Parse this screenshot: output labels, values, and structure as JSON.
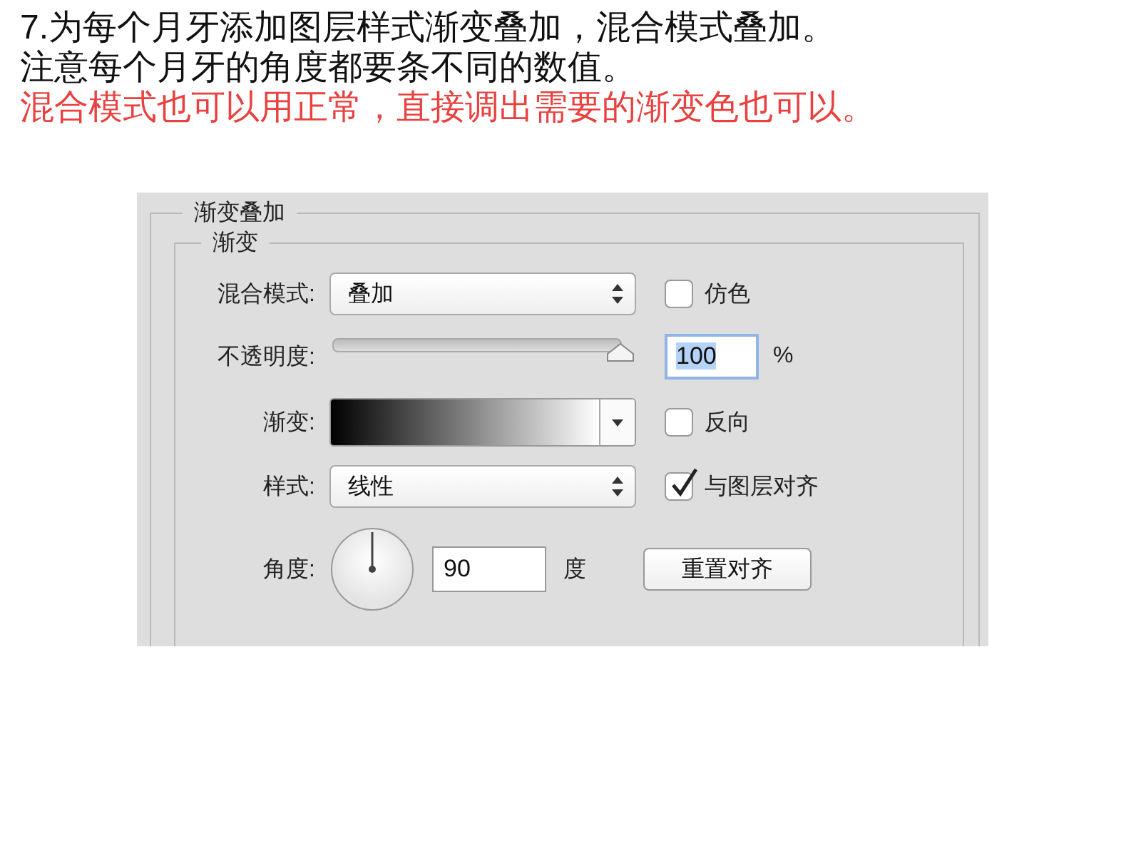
{
  "instructions": [
    {
      "text": "7.为每个月牙添加图层样式渐变叠加，混合模式叠加。",
      "kind": "normal"
    },
    {
      "text": "注意每个月牙的角度都要条不同的数值。",
      "kind": "normal"
    },
    {
      "text": "混合模式也可以用正常，直接调出需要的渐变色也可以。",
      "kind": "note"
    }
  ],
  "panel": {
    "title": "渐变叠加",
    "group": "渐变",
    "blend_mode": {
      "label": "混合模式:",
      "value": "叠加"
    },
    "dither": {
      "label": "仿色",
      "checked": false
    },
    "opacity": {
      "label": "不透明度:",
      "level": 1.0,
      "value": "100",
      "unit": "%"
    },
    "gradient": {
      "label": "渐变:"
    },
    "reverse": {
      "label": "反向",
      "checked": false
    },
    "style": {
      "label": "样式:",
      "value": "线性"
    },
    "align": {
      "label": "与图层对齐",
      "checked": true
    },
    "angle": {
      "label": "角度:",
      "value": "90",
      "unit": "度"
    },
    "reset_button": "重置对齐"
  }
}
